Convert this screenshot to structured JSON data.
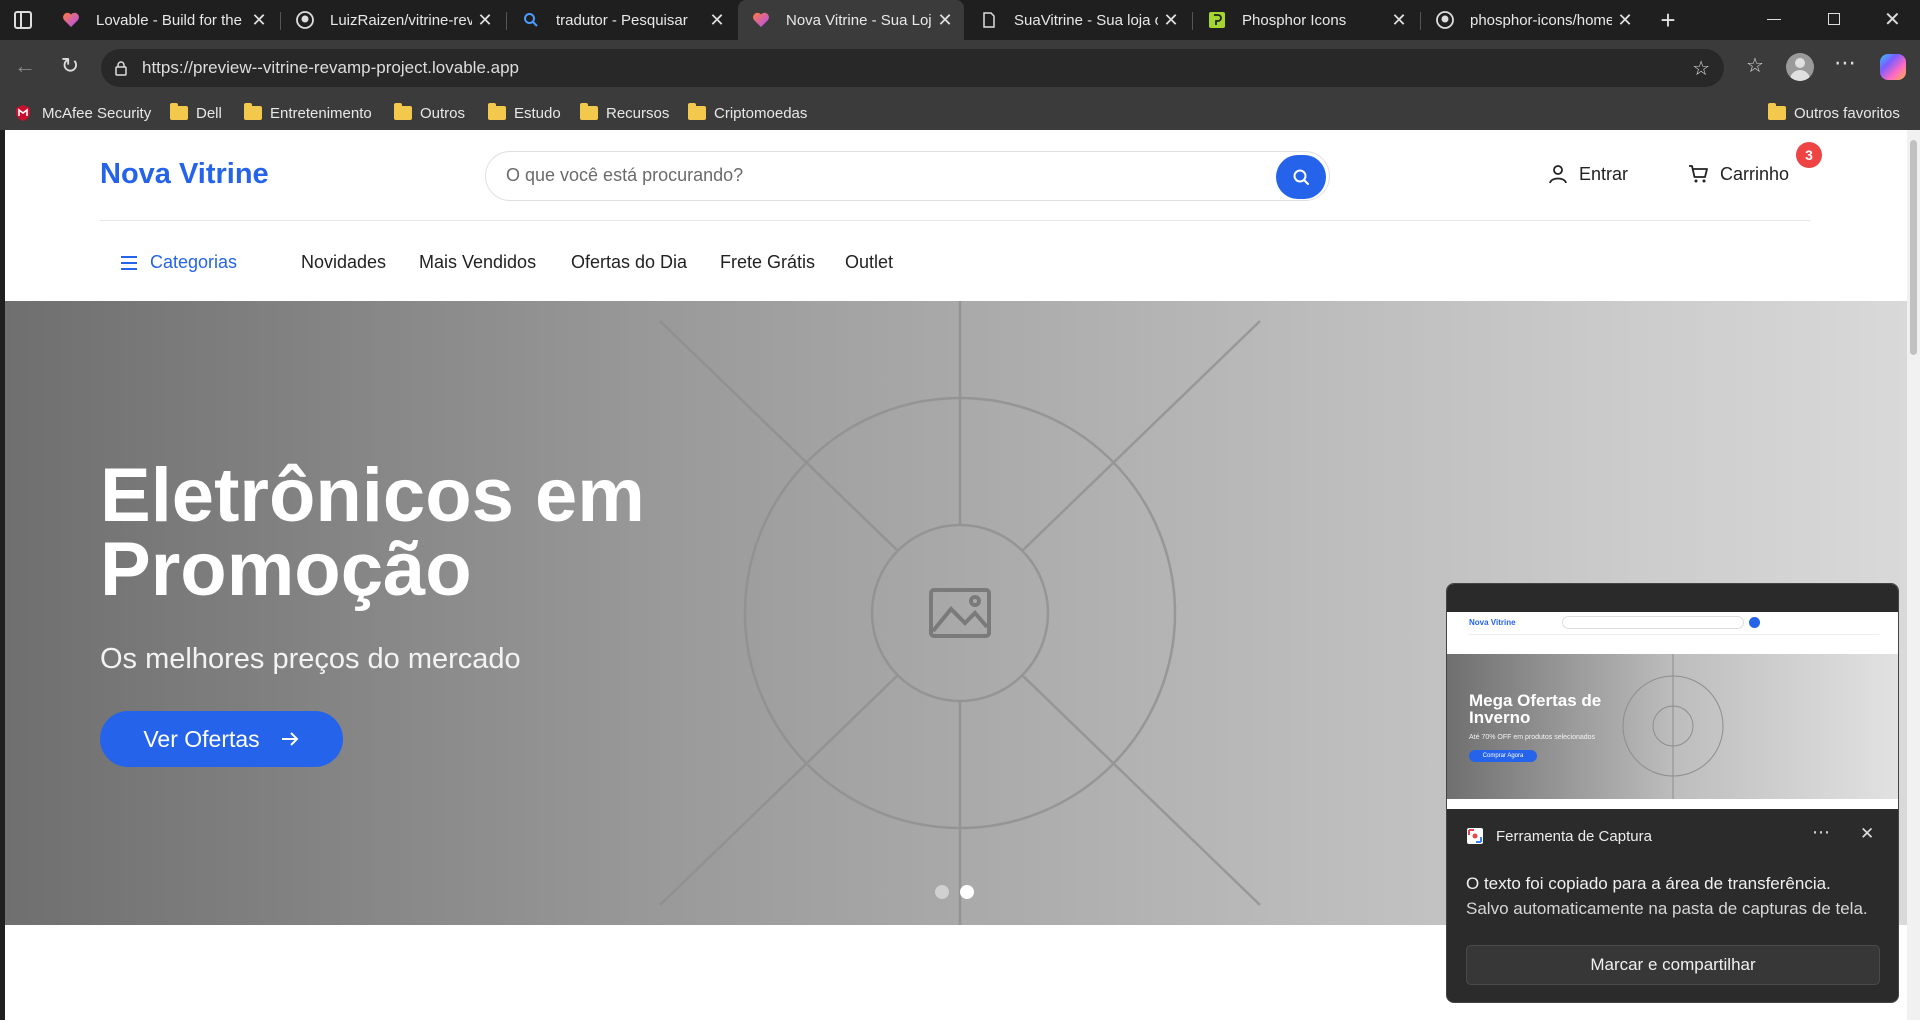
{
  "browser": {
    "tabs": [
      {
        "title": "Lovable - Build for the",
        "icon": "lovable-heart-icon",
        "active": false
      },
      {
        "title": "LuizRaizen/vitrine-reva",
        "icon": "github-icon",
        "active": false
      },
      {
        "title": "tradutor - Pesquisar",
        "icon": "bing-search-icon",
        "active": false
      },
      {
        "title": "Nova Vitrine - Sua Loja",
        "icon": "lovable-heart-icon",
        "active": true
      },
      {
        "title": "SuaVitrine - Sua loja o",
        "icon": "document-icon",
        "active": false
      },
      {
        "title": "Phosphor Icons",
        "icon": "phosphor-icon",
        "active": false
      },
      {
        "title": "phosphor-icons/home",
        "icon": "github-icon",
        "active": false
      }
    ],
    "url": "https://preview--vitrine-revamp-project.lovable.app",
    "bookmarks": [
      "McAfee Security",
      "Dell",
      "Entretenimento",
      "Outros",
      "Estudo",
      "Recursos",
      "Criptomoedas"
    ],
    "other_favorites": "Outros favoritos"
  },
  "store": {
    "logo": "Nova Vitrine",
    "search_placeholder": "O que você está procurando?",
    "login_label": "Entrar",
    "cart_label": "Carrinho",
    "cart_count": "3",
    "categories_label": "Categorias",
    "nav_links": [
      "Novidades",
      "Mais Vendidos",
      "Ofertas do Dia",
      "Frete Grátis",
      "Outlet"
    ]
  },
  "hero": {
    "title": "Eletrônicos em Promoção",
    "subtitle": "Os melhores preços do mercado",
    "cta": "Ver Ofertas",
    "slides": 2,
    "active_slide": 2
  },
  "snip_notification": {
    "app_name": "Ferramenta de Captura",
    "message_line1": "O texto foi copiado para a área de transferência.",
    "message_line2": "Salvo automaticamente na pasta de capturas de tela.",
    "action": "Marcar e compartilhar",
    "thumbnail": {
      "logo": "Nova Vitrine",
      "hero_title": "Mega Ofertas de Inverno",
      "hero_subtitle": "Até 70% OFF em produtos selecionados",
      "hero_cta": "Comprar Agora"
    }
  },
  "colors": {
    "brand": "#2563eb",
    "badge": "#ef4444",
    "browser_chrome": "#3b3b3b"
  }
}
